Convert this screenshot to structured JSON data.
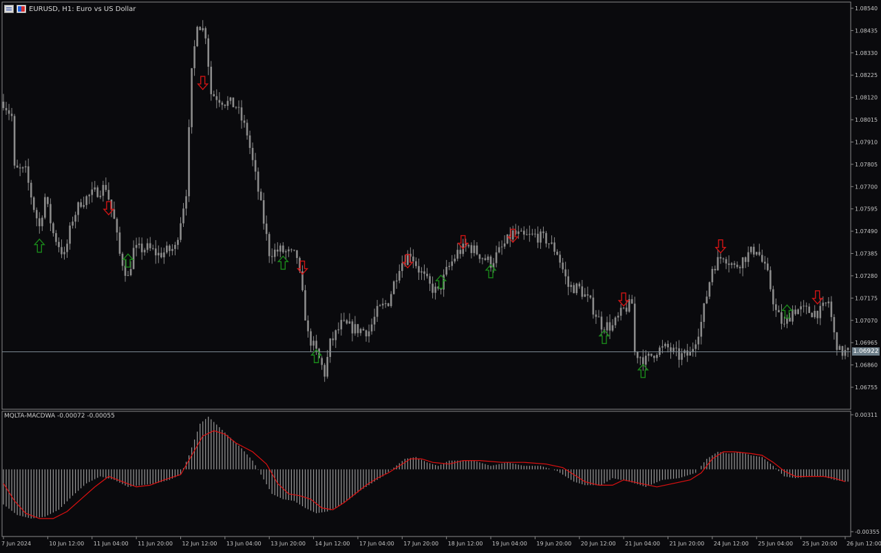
{
  "header": {
    "symbol_title": "EURUSD, H1:  Euro vs US Dollar",
    "indicator_title": "MQLTA-MACDWA -0.00072 -0.00055",
    "current_price": "1.06922"
  },
  "colors": {
    "background": "#0a0a0d",
    "candles": "#8c8c8c",
    "grid_frame": "#8a8a8a",
    "price_line": "#7d8b94",
    "buy_arrow": "#1a8a1a",
    "sell_arrow": "#d01414",
    "signal_line": "#e01010",
    "histogram": "#9a9a9a"
  },
  "chart_data": [
    {
      "type": "line",
      "title": "EURUSD, H1:  Euro vs US Dollar",
      "series_style": "candlestick (H1 bars, approximated as close path)",
      "xlabel": "",
      "ylabel": "",
      "ylim": [
        1.0668,
        1.0856
      ],
      "y_ticks": [
        "1.08540",
        "1.08435",
        "1.08330",
        "1.08225",
        "1.08120",
        "1.08015",
        "1.07910",
        "1.07805",
        "1.07700",
        "1.07595",
        "1.07490",
        "1.07385",
        "1.07280",
        "1.07175",
        "1.07070",
        "1.06965",
        "1.06860",
        "1.06755"
      ],
      "y_tick_values": [
        1.0854,
        1.08435,
        1.0833,
        1.08225,
        1.0812,
        1.08015,
        1.0791,
        1.07805,
        1.077,
        1.07595,
        1.0749,
        1.07385,
        1.0728,
        1.07175,
        1.0707,
        1.06965,
        1.0686,
        1.06755
      ],
      "x_range": [
        0,
        305
      ],
      "x_ticks": [
        {
          "i": 0,
          "label": "7 Jun 2024"
        },
        {
          "i": 16,
          "label": "10 Jun 12:00"
        },
        {
          "i": 32,
          "label": "11 Jun 04:00"
        },
        {
          "i": 48,
          "label": "11 Jun 20:00"
        },
        {
          "i": 64,
          "label": "12 Jun 12:00"
        },
        {
          "i": 80,
          "label": "13 Jun 04:00"
        },
        {
          "i": 96,
          "label": "13 Jun 20:00"
        },
        {
          "i": 112,
          "label": "14 Jun 12:00"
        },
        {
          "i": 128,
          "label": "17 Jun 04:00"
        },
        {
          "i": 144,
          "label": "17 Jun 20:00"
        },
        {
          "i": 160,
          "label": "18 Jun 12:00"
        },
        {
          "i": 176,
          "label": "19 Jun 04:00"
        },
        {
          "i": 192,
          "label": "19 Jun 20:00"
        },
        {
          "i": 208,
          "label": "20 Jun 12:00"
        },
        {
          "i": 224,
          "label": "21 Jun 04:00"
        },
        {
          "i": 240,
          "label": "21 Jun 20:00"
        },
        {
          "i": 256,
          "label": "24 Jun 12:00"
        },
        {
          "i": 272,
          "label": "25 Jun 04:00"
        },
        {
          "i": 288,
          "label": "25 Jun 20:00"
        },
        {
          "i": 304,
          "label": "26 Jun 12:00"
        }
      ],
      "price_path": [
        [
          0,
          1.081
        ],
        [
          3,
          1.0803
        ],
        [
          4,
          1.0778
        ],
        [
          8,
          1.0777
        ],
        [
          11,
          1.076
        ],
        [
          13,
          1.0751
        ],
        [
          15,
          1.0765
        ],
        [
          18,
          1.0748
        ],
        [
          22,
          1.0737
        ],
        [
          25,
          1.0755
        ],
        [
          28,
          1.0763
        ],
        [
          34,
          1.0768
        ],
        [
          37,
          1.077
        ],
        [
          40,
          1.0754
        ],
        [
          42,
          1.0738
        ],
        [
          45,
          1.0727
        ],
        [
          47,
          1.074
        ],
        [
          52,
          1.0741
        ],
        [
          56,
          1.0738
        ],
        [
          62,
          1.0741
        ],
        [
          66,
          1.0768
        ],
        [
          68,
          1.0823
        ],
        [
          70,
          1.0848
        ],
        [
          73,
          1.0842
        ],
        [
          75,
          1.0814
        ],
        [
          80,
          1.081
        ],
        [
          84,
          1.0808
        ],
        [
          88,
          1.0795
        ],
        [
          92,
          1.0768
        ],
        [
          96,
          1.0739
        ],
        [
          100,
          1.074
        ],
        [
          104,
          1.0738
        ],
        [
          106,
          1.0737
        ],
        [
          110,
          1.07
        ],
        [
          113,
          1.0692
        ],
        [
          116,
          1.0682
        ],
        [
          118,
          1.0696
        ],
        [
          122,
          1.0705
        ],
        [
          127,
          1.0703
        ],
        [
          132,
          1.0702
        ],
        [
          135,
          1.0711
        ],
        [
          139,
          1.0716
        ],
        [
          143,
          1.0733
        ],
        [
          147,
          1.0739
        ],
        [
          150,
          1.0731
        ],
        [
          154,
          1.0723
        ],
        [
          157,
          1.072
        ],
        [
          160,
          1.073
        ],
        [
          164,
          1.0739
        ],
        [
          168,
          1.0742
        ],
        [
          172,
          1.0738
        ],
        [
          176,
          1.0734
        ],
        [
          180,
          1.0741
        ],
        [
          184,
          1.0748
        ],
        [
          188,
          1.0746
        ],
        [
          192,
          1.0747
        ],
        [
          196,
          1.0745
        ],
        [
          200,
          1.0739
        ],
        [
          204,
          1.0723
        ],
        [
          208,
          1.0722
        ],
        [
          212,
          1.0715
        ],
        [
          216,
          1.0705
        ],
        [
          220,
          1.0704
        ],
        [
          224,
          1.0712
        ],
        [
          227,
          1.0715
        ],
        [
          228,
          1.0692
        ],
        [
          232,
          1.0688
        ],
        [
          236,
          1.0693
        ],
        [
          240,
          1.0694
        ],
        [
          244,
          1.069
        ],
        [
          248,
          1.0691
        ],
        [
          252,
          1.0706
        ],
        [
          256,
          1.0732
        ],
        [
          260,
          1.0738
        ],
        [
          264,
          1.0732
        ],
        [
          268,
          1.0737
        ],
        [
          272,
          1.0741
        ],
        [
          276,
          1.0728
        ],
        [
          279,
          1.0711
        ],
        [
          282,
          1.0704
        ],
        [
          285,
          1.0712
        ],
        [
          288,
          1.0712
        ],
        [
          292,
          1.0711
        ],
        [
          295,
          1.0711
        ],
        [
          298,
          1.0716
        ],
        [
          300,
          1.07
        ],
        [
          302,
          1.0692
        ],
        [
          305,
          1.0692
        ]
      ],
      "current_price": 1.06922,
      "buy_signals": [
        [
          13,
          1.0742
        ],
        [
          45,
          1.0735
        ],
        [
          101,
          1.0734
        ],
        [
          113,
          1.069
        ],
        [
          158,
          1.0725
        ],
        [
          176,
          1.073
        ],
        [
          217,
          1.0699
        ],
        [
          231,
          1.0683
        ],
        [
          283,
          1.0711
        ]
      ],
      "sell_signals": [
        [
          38,
          1.076
        ],
        [
          72,
          1.0819
        ],
        [
          108,
          1.0732
        ],
        [
          146,
          1.0735
        ],
        [
          166,
          1.0744
        ],
        [
          184,
          1.0747
        ],
        [
          224,
          1.0717
        ],
        [
          259,
          1.0742
        ],
        [
          294,
          1.0718
        ]
      ]
    },
    {
      "type": "bar",
      "title": "MQLTA-MACDWA -0.00072 -0.00055",
      "ylim": [
        -0.00355,
        0.00311
      ],
      "y_ticks": [
        "0.00311",
        "-0.00355"
      ],
      "y_tick_values": [
        0.00311,
        -0.00355
      ],
      "histogram_anchors": [
        [
          0,
          -0.002
        ],
        [
          5,
          -0.0026
        ],
        [
          10,
          -0.0028
        ],
        [
          15,
          -0.0027
        ],
        [
          20,
          -0.0023
        ],
        [
          25,
          -0.0015
        ],
        [
          30,
          -0.0008
        ],
        [
          35,
          -0.0004
        ],
        [
          40,
          -0.0006
        ],
        [
          45,
          -0.001
        ],
        [
          50,
          -0.0009
        ],
        [
          55,
          -0.0008
        ],
        [
          60,
          -0.0006
        ],
        [
          64,
          -0.0003
        ],
        [
          67,
          0.0008
        ],
        [
          71,
          0.0026
        ],
        [
          74,
          0.003
        ],
        [
          78,
          0.0024
        ],
        [
          82,
          0.0018
        ],
        [
          86,
          0.0012
        ],
        [
          90,
          0.0005
        ],
        [
          93,
          -0.0003
        ],
        [
          97,
          -0.0014
        ],
        [
          101,
          -0.0017
        ],
        [
          105,
          -0.0018
        ],
        [
          109,
          -0.0022
        ],
        [
          113,
          -0.0025
        ],
        [
          117,
          -0.0024
        ],
        [
          121,
          -0.0021
        ],
        [
          125,
          -0.0017
        ],
        [
          129,
          -0.0012
        ],
        [
          133,
          -0.0008
        ],
        [
          137,
          -0.0004
        ],
        [
          141,
          0.0001
        ],
        [
          145,
          0.0006
        ],
        [
          149,
          0.0007
        ],
        [
          153,
          0.0004
        ],
        [
          157,
          0.0002
        ],
        [
          161,
          0.0005
        ],
        [
          165,
          0.0005
        ],
        [
          170,
          0.0005
        ],
        [
          176,
          0.0002
        ],
        [
          182,
          0.0004
        ],
        [
          188,
          0.0002
        ],
        [
          194,
          0.0002
        ],
        [
          200,
          -0.0001
        ],
        [
          206,
          -0.0007
        ],
        [
          210,
          -0.0009
        ],
        [
          216,
          -0.0009
        ],
        [
          220,
          -0.0005
        ],
        [
          226,
          -0.0007
        ],
        [
          232,
          -0.001
        ],
        [
          238,
          -0.0006
        ],
        [
          244,
          -0.0005
        ],
        [
          250,
          -0.0002
        ],
        [
          254,
          0.0006
        ],
        [
          258,
          0.001
        ],
        [
          262,
          0.0009
        ],
        [
          266,
          0.001
        ],
        [
          270,
          0.0008
        ],
        [
          274,
          0.0007
        ],
        [
          278,
          0.0002
        ],
        [
          282,
          -0.0004
        ],
        [
          286,
          -0.0005
        ],
        [
          292,
          -0.0004
        ],
        [
          296,
          -0.0004
        ],
        [
          300,
          -0.0006
        ],
        [
          304,
          -0.0007
        ]
      ],
      "signal_line": [
        [
          0,
          -0.0008
        ],
        [
          4,
          -0.0018
        ],
        [
          8,
          -0.0025
        ],
        [
          13,
          -0.0028
        ],
        [
          18,
          -0.0028
        ],
        [
          23,
          -0.0024
        ],
        [
          28,
          -0.0017
        ],
        [
          33,
          -0.001
        ],
        [
          38,
          -0.0004
        ],
        [
          43,
          -0.0007
        ],
        [
          48,
          -0.001
        ],
        [
          53,
          -0.0009
        ],
        [
          58,
          -0.0006
        ],
        [
          64,
          -0.0003
        ],
        [
          68,
          0.0008
        ],
        [
          72,
          0.0019
        ],
        [
          76,
          0.0022
        ],
        [
          80,
          0.002
        ],
        [
          84,
          0.0015
        ],
        [
          90,
          0.001
        ],
        [
          95,
          0.0003
        ],
        [
          99,
          -0.0008
        ],
        [
          103,
          -0.0014
        ],
        [
          107,
          -0.0015
        ],
        [
          111,
          -0.0017
        ],
        [
          115,
          -0.0022
        ],
        [
          119,
          -0.0023
        ],
        [
          123,
          -0.0019
        ],
        [
          127,
          -0.0014
        ],
        [
          131,
          -0.0009
        ],
        [
          135,
          -0.0005
        ],
        [
          139,
          -0.0002
        ],
        [
          143,
          0.0002
        ],
        [
          147,
          0.0006
        ],
        [
          151,
          0.0006
        ],
        [
          155,
          0.0004
        ],
        [
          161,
          0.0003
        ],
        [
          166,
          0.0005
        ],
        [
          172,
          0.0005
        ],
        [
          180,
          0.0004
        ],
        [
          188,
          0.0004
        ],
        [
          196,
          0.0003
        ],
        [
          202,
          0.0001
        ],
        [
          206,
          -0.0003
        ],
        [
          210,
          -0.0007
        ],
        [
          215,
          -0.0009
        ],
        [
          220,
          -0.0009
        ],
        [
          224,
          -0.0006
        ],
        [
          230,
          -0.0008
        ],
        [
          236,
          -0.001
        ],
        [
          242,
          -0.0008
        ],
        [
          248,
          -0.0006
        ],
        [
          252,
          -0.0002
        ],
        [
          256,
          0.0006
        ],
        [
          260,
          0.001
        ],
        [
          264,
          0.001
        ],
        [
          270,
          0.0009
        ],
        [
          274,
          0.0008
        ],
        [
          278,
          0.0004
        ],
        [
          282,
          -0.0001
        ],
        [
          286,
          -0.0004
        ],
        [
          292,
          -0.0004
        ],
        [
          296,
          -0.0004
        ],
        [
          300,
          -0.0005
        ],
        [
          304,
          -0.0007
        ]
      ]
    }
  ]
}
